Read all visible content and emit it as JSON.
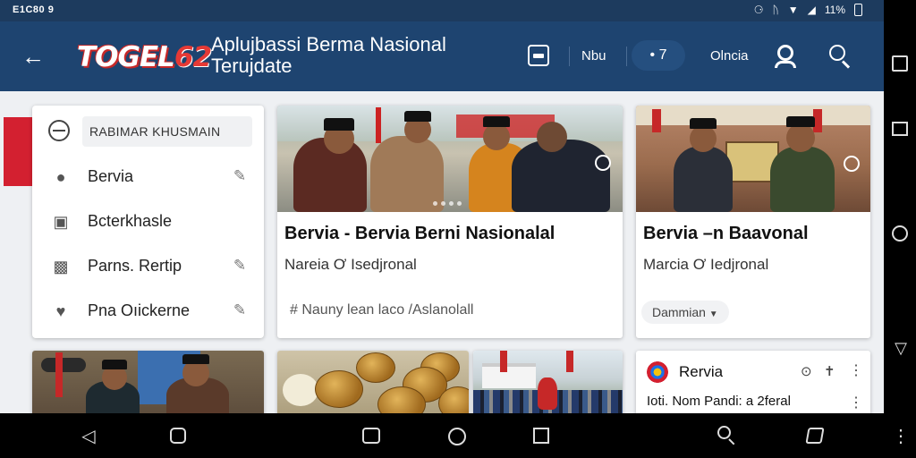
{
  "status_bar": {
    "time": "E1C80 9",
    "battery": "11%"
  },
  "app_bar": {
    "logo_text": "TOGEL",
    "logo_number": "62",
    "title": "Aplujbassi Berma Nasional Terujdate",
    "action_1": "Nbu",
    "action_2": "• 7",
    "action_3": "Olncia"
  },
  "menu": {
    "header": "RABIMAR KHUSMAIN",
    "items": [
      {
        "label": "Bervia",
        "icon": "location-pin-icon",
        "editable": true
      },
      {
        "label": "Bcterkhasle",
        "icon": "puzzle-icon",
        "editable": false
      },
      {
        "label": "Parns. Rertip",
        "icon": "group-icon",
        "editable": true
      },
      {
        "label": "Pna Oıickerne",
        "icon": "heart-icon",
        "editable": true
      }
    ]
  },
  "cards": {
    "main": {
      "title": "Bervia - Bervia Berni Nasionalal",
      "subtitle": "Nareia Ơ Isedjronal",
      "meta": "# Nauny lean laco /Aslanolall"
    },
    "side": {
      "title": "Bervia –n Baavonal",
      "subtitle": "Marcia Ơ Iedjronal",
      "chip": "Dammian"
    },
    "small_news": {
      "title": "Rervia",
      "subtitle": "Ioti. Nom Pandi: a 2feral"
    }
  },
  "colors": {
    "appbar": "#1e4470",
    "statusbar": "#1d3b5e",
    "accent_red": "#d32030"
  }
}
